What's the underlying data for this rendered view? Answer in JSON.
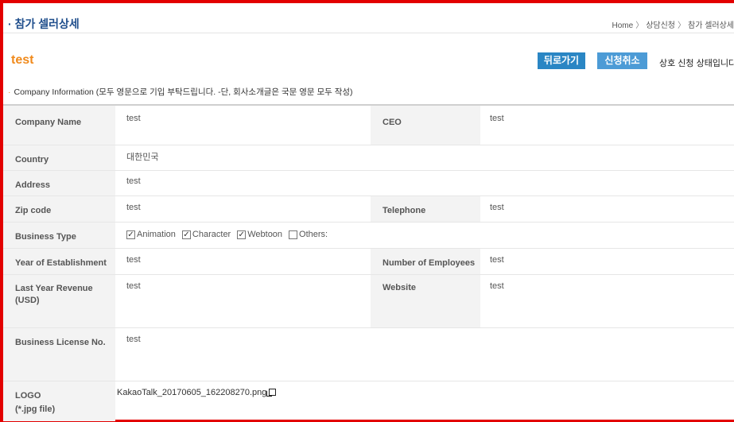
{
  "header": {
    "title": "참가 셀러상세",
    "breadcrumb": [
      "Home",
      "상담신청",
      "참가 셀러상세"
    ]
  },
  "seller": {
    "name": "test",
    "back_label": "뒤로가기",
    "cancel_label": "신청취소",
    "status": "상호 신청 상태입니다."
  },
  "section": {
    "title": "Company Information (모두 영문으로 기입 부탁드립니다. -단, 회사소개글은 국문 영문 모두 작성)"
  },
  "fields": {
    "company_name": {
      "label": "Company Name",
      "value": "test"
    },
    "ceo": {
      "label": "CEO",
      "value": "test"
    },
    "country": {
      "label": "Country",
      "value": "대한민국"
    },
    "address": {
      "label": "Address",
      "value": "test"
    },
    "zip_code": {
      "label": "Zip code",
      "value": "test"
    },
    "telephone": {
      "label": "Telephone",
      "value": "test"
    },
    "business_type": {
      "label": "Business Type",
      "options": [
        {
          "label": "Animation",
          "checked": true
        },
        {
          "label": "Character",
          "checked": true
        },
        {
          "label": "Webtoon",
          "checked": true
        },
        {
          "label": "Others:",
          "checked": false
        }
      ]
    },
    "year_established": {
      "label": "Year of Establishment",
      "value": "test"
    },
    "employees": {
      "label": "Number of Employees",
      "value": "test"
    },
    "revenue": {
      "label": "Last Year Revenue (USD)",
      "value": "test"
    },
    "website": {
      "label": "Website",
      "value": "test"
    },
    "license": {
      "label": "Business License No.",
      "value": "test"
    },
    "logo": {
      "label": "LOGO (*.jpg file)",
      "label_line1": "LOGO",
      "label_line2": "(*.jpg file)",
      "value": "KakaoTalk_20170605_162208270.png"
    }
  },
  "colors": {
    "frame": "#e30000",
    "title": "#1f4e8c",
    "seller_name": "#f08a1c",
    "button_back": "#2a86c4",
    "button_cancel": "#4c9bd6"
  }
}
